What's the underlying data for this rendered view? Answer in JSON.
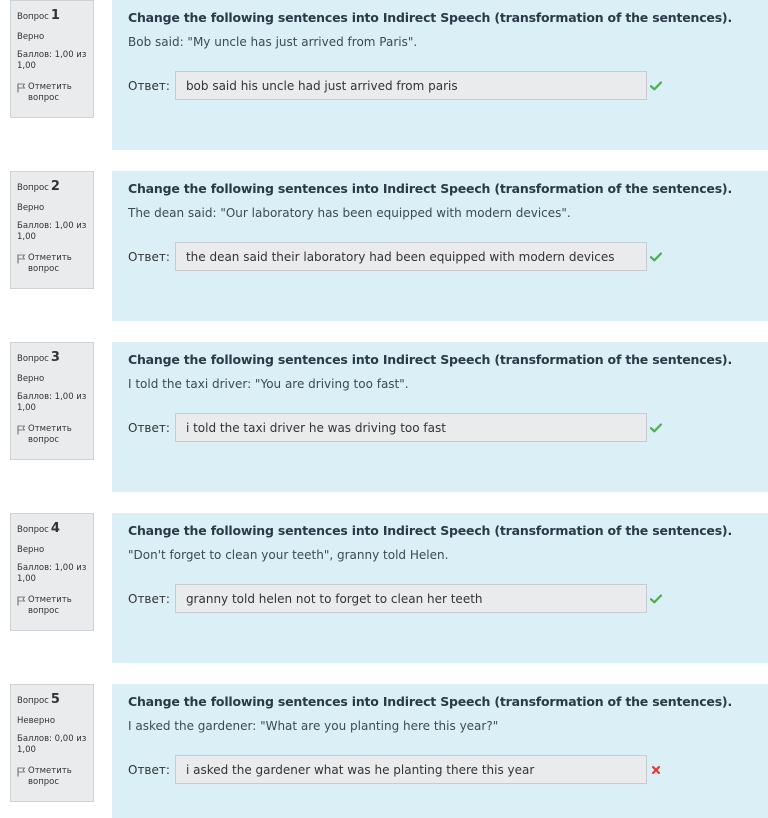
{
  "questions": [
    {
      "label": "Вопрос",
      "number": "1",
      "state": "Верно",
      "grade": "Баллов: 1,00 из 1,00",
      "flag": "Отметить вопрос",
      "title": "Change the following sentences into Indirect Speech (transformation of the sentences).",
      "text": "Bob said: \"My uncle has just arrived from Paris\".",
      "answer_label": "Ответ:",
      "answer": "bob said his uncle had just arrived from paris",
      "correct": true
    },
    {
      "label": "Вопрос",
      "number": "2",
      "state": "Верно",
      "grade": "Баллов: 1,00 из 1,00",
      "flag": "Отметить вопрос",
      "title": "Change the following sentences into Indirect Speech (transformation of the sentences).",
      "text": "The dean said: \"Our laboratory has been equipped with modern devices\".",
      "answer_label": "Ответ:",
      "answer": "the dean said their laboratory had been equipped with modern devices",
      "correct": true
    },
    {
      "label": "Вопрос",
      "number": "3",
      "state": "Верно",
      "grade": "Баллов: 1,00 из 1,00",
      "flag": "Отметить вопрос",
      "title": "Change the following sentences into Indirect Speech (transformation of the sentences).",
      "text": "I told the taxi driver:  \"You are driving too fast\".",
      "answer_label": "Ответ:",
      "answer": "i told the taxi driver he was driving too fast",
      "correct": true
    },
    {
      "label": "Вопрос",
      "number": "4",
      "state": "Верно",
      "grade": "Баллов: 1,00 из 1,00",
      "flag": "Отметить вопрос",
      "title": "Change the following sentences into Indirect Speech (transformation of the sentences).",
      "text": "\"Don't forget to clean your teeth\", granny told Helen.",
      "answer_label": "Ответ:",
      "answer": "granny told helen not to forget to clean her teeth",
      "correct": true
    },
    {
      "label": "Вопрос",
      "number": "5",
      "state": "Неверно",
      "grade": "Баллов: 0,00 из 1,00",
      "flag": "Отметить вопрос",
      "title": "Change the following sentences into Indirect Speech (transformation of the sentences).",
      "text": "I asked the gardener: \"What are you planting here this year?\"",
      "answer_label": "Ответ:",
      "answer": "i asked the gardener what was he planting there this year",
      "correct": false
    }
  ],
  "colors": {
    "content_bg": "#dbeff6",
    "info_bg": "#e9ebed",
    "correct": "#4caf50",
    "incorrect": "#e53935"
  }
}
